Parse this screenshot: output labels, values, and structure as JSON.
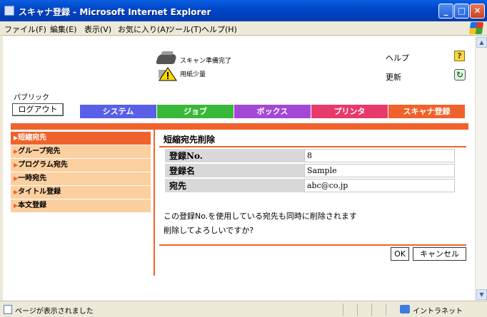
{
  "window": {
    "title": "スキャナ登録 - Microsoft Internet Explorer"
  },
  "menu": [
    "ファイル(F)",
    "編集(E)",
    "表示(V)",
    "お気に入り(A)",
    "ツール(T)",
    "ヘルプ(H)"
  ],
  "status_panel": {
    "scan_status": "スキャン準備完了",
    "paper_status": "用紙少量",
    "help": "ヘルプ",
    "refresh": "更新",
    "help_icon_glyph": "?"
  },
  "user_mode": "パブリック",
  "logout": "ログアウト",
  "tabs": [
    {
      "label": "システム",
      "color": "#5a5fe8"
    },
    {
      "label": "ジョブ",
      "color": "#3ab83a"
    },
    {
      "label": "ボックス",
      "color": "#a347d6"
    },
    {
      "label": "プリンタ",
      "color": "#e83a6a"
    },
    {
      "label": "スキャナ登録",
      "color": "#f0622b"
    }
  ],
  "sidebar": {
    "items": [
      {
        "label": "短縮宛先",
        "active": true
      },
      {
        "label": "グループ宛先",
        "active": false
      },
      {
        "label": "プログラム宛先",
        "active": false
      },
      {
        "label": "一時宛先",
        "active": false
      },
      {
        "label": "タイトル登録",
        "active": false
      },
      {
        "label": "本文登録",
        "active": false
      }
    ]
  },
  "main": {
    "title": "短縮宛先削除",
    "rows": [
      {
        "label": "登録No.",
        "value": "8"
      },
      {
        "label": "登録名",
        "value": "Sample"
      },
      {
        "label": "宛先",
        "value": "abc@co.jp"
      }
    ],
    "message_line1": "この登録No.を使用している宛先も同時に削除されます",
    "message_line2": "削除してよろしいですか?",
    "ok": "OK",
    "cancel": "キャンセル"
  },
  "statusbar": {
    "text": "ページが表示されました",
    "zone": "イントラネット"
  },
  "colors": {
    "accent": "#f0622b",
    "menu_bg": "#fbcf9f"
  }
}
